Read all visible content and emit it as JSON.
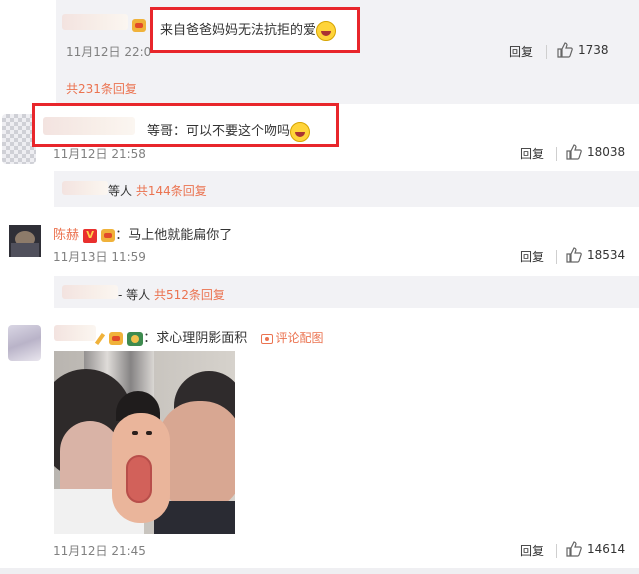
{
  "comments": [
    {
      "text": "来自爸爸妈妈无法抗拒的爱",
      "time": "11月12日 22:0",
      "reply_label": "回复",
      "likes": "1738",
      "more_replies": "共231条回复"
    },
    {
      "text": "等哥：可以不要这个吻吗",
      "time": "11月12日 21:58",
      "reply_label": "回复",
      "likes": "18038",
      "sub_suffix": "等人",
      "sub_link": "共144条回复"
    },
    {
      "username": "陈赫",
      "text": "：马上他就能扁你了",
      "time": "11月13日 11:59",
      "reply_label": "回复",
      "likes": "18534",
      "sub_suffix": "- 等人",
      "sub_link": "共512条回复"
    },
    {
      "text": "：求心理阴影面积",
      "attach_label": "评论配图",
      "time": "11月12日 21:45",
      "reply_label": "回复",
      "likes": "14614"
    }
  ],
  "colors": {
    "link": "#eb7350",
    "highlight": "#e8262b",
    "nested_bg": "#f2f2f5"
  }
}
